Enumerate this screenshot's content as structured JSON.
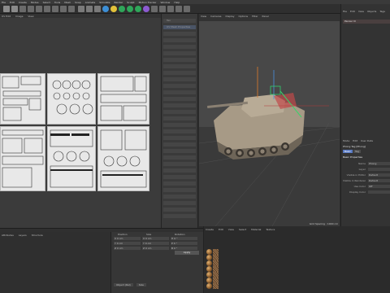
{
  "menubar": {
    "items": [
      "File",
      "Edit",
      "Create",
      "Modes",
      "Select",
      "Tools",
      "Mesh",
      "Snap",
      "Animate",
      "Simulate",
      "Render",
      "Sculpt",
      "Motion Tracker",
      "Window",
      "Help"
    ]
  },
  "uv": {
    "header": [
      "UV Edit",
      "Image",
      "View"
    ]
  },
  "list": {
    "items": [
      "Tex",
      "UV Mesh Properties",
      "",
      "",
      "",
      "",
      "",
      "",
      "",
      "",
      "",
      "",
      "",
      "",
      "",
      "",
      "",
      "",
      "",
      "",
      "",
      "",
      "",
      "",
      "",
      "",
      "",
      "",
      "",
      "",
      ""
    ]
  },
  "viewport": {
    "menu": [
      "View",
      "Cameras",
      "Display",
      "Options",
      "Filter",
      "Panel"
    ],
    "title": "Perspective",
    "camera": "Default Camera",
    "footer": "Grid Spacing : 1000 cm"
  },
  "objects": {
    "menu": [
      "File",
      "Edit",
      "View",
      "Objects",
      "Tags"
    ],
    "selected": "Panzer III"
  },
  "attributes": {
    "menu": [
      "Mode",
      "Edit",
      "User Data"
    ],
    "name": "Phong Tag [Phong]",
    "tabs": [
      "Basic",
      "Tag"
    ],
    "section": "Basic Properties",
    "rows": [
      {
        "label": "Name",
        "value": "Phong"
      },
      {
        "label": "Layer",
        "value": ""
      },
      {
        "label": "Visible in Editor",
        "value": "Default"
      },
      {
        "label": "Visible in Renderer",
        "value": "Default"
      },
      {
        "label": "Use Color",
        "value": "Off"
      },
      {
        "label": "Display Color",
        "value": ""
      }
    ]
  },
  "bottom": {
    "tabs": [
      "Attributes",
      "Layers",
      "Structure"
    ]
  },
  "coords": {
    "headers": [
      "Position",
      "Size",
      "Rotation"
    ],
    "rows": [
      [
        "X  0 cm",
        "X  0 cm",
        "H  0 °"
      ],
      [
        "Y  0 cm",
        "Y  0 cm",
        "P  0 °"
      ],
      [
        "Z  0 cm",
        "Z  0 cm",
        "B  0 °"
      ],
      [
        "Object (Rel)",
        "Size",
        ""
      ]
    ],
    "apply": "Apply",
    "bottom": [
      "Object (Rel)",
      "Size"
    ]
  },
  "materials": {
    "menu": [
      "Create",
      "Edit",
      "View",
      "Select",
      "Material",
      "Texture"
    ]
  }
}
